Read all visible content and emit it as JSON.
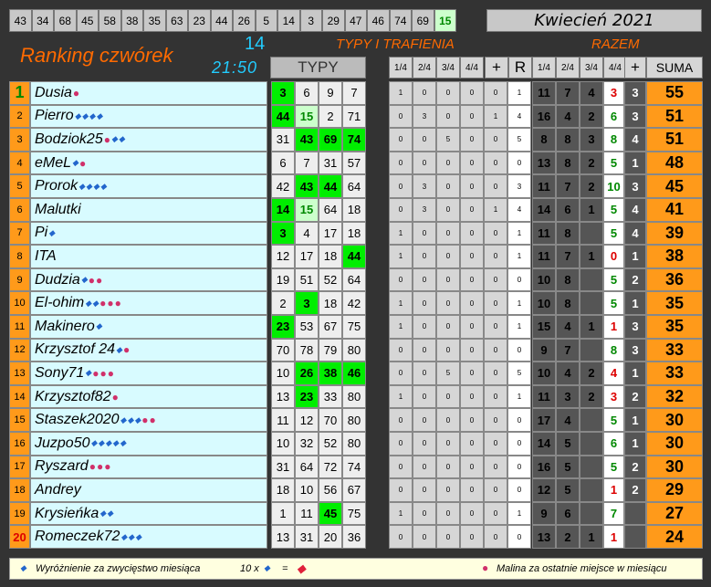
{
  "header": {
    "top_numbers": [
      "43",
      "34",
      "68",
      "45",
      "58",
      "38",
      "35",
      "63",
      "23",
      "44",
      "26",
      "5",
      "14",
      "3",
      "29",
      "47",
      "46",
      "74",
      "69",
      "15"
    ],
    "highlight_index": 19,
    "month": "Kwiecień 2021",
    "title": "Ranking czwórek",
    "draw_count": "14",
    "time": "21:50",
    "typy_label": "TYPY",
    "typy_trafienia": "TYPY I TRAFIENIA",
    "razem": "RAZEM",
    "col_labels": [
      "1/4",
      "2/4",
      "3/4",
      "4/4",
      "+",
      "R",
      "1/4",
      "2/4",
      "3/4",
      "4/4",
      "+"
    ],
    "suma": "SUMA"
  },
  "rows": [
    {
      "rank": "1",
      "name": "Dusia",
      "marks": "b",
      "picks": [
        "3",
        "6",
        "9",
        "7"
      ],
      "green": [
        0
      ],
      "lg": [],
      "t": [
        "1",
        "0",
        "0",
        "0",
        "0",
        "1"
      ],
      "r": [
        "11",
        "7",
        "4",
        "3",
        "3"
      ],
      "r4class": "rd",
      "sum": "55"
    },
    {
      "rank": "2",
      "name": "Pierro",
      "marks": "dddd",
      "picks": [
        "44",
        "15",
        "2",
        "71"
      ],
      "green": [
        0
      ],
      "lg": [
        1
      ],
      "t": [
        "0",
        "3",
        "0",
        "0",
        "1",
        "4"
      ],
      "r": [
        "16",
        "4",
        "2",
        "6",
        "3"
      ],
      "r4class": "gn",
      "sum": "51"
    },
    {
      "rank": "3",
      "name": "Bodziok25",
      "marks": "bdd",
      "picks": [
        "31",
        "43",
        "69",
        "74"
      ],
      "green": [
        1,
        2,
        3
      ],
      "lg": [],
      "t": [
        "0",
        "0",
        "5",
        "0",
        "0",
        "5"
      ],
      "r": [
        "8",
        "8",
        "3",
        "8",
        "4"
      ],
      "r4class": "gn",
      "sum": "51"
    },
    {
      "rank": "4",
      "name": "eMeL",
      "marks": "db",
      "picks": [
        "6",
        "7",
        "31",
        "57"
      ],
      "green": [],
      "lg": [],
      "t": [
        "0",
        "0",
        "0",
        "0",
        "0",
        "0"
      ],
      "r": [
        "13",
        "8",
        "2",
        "5",
        "1"
      ],
      "r4class": "gn",
      "sum": "48"
    },
    {
      "rank": "5",
      "name": "Prorok",
      "marks": "dddd",
      "picks": [
        "42",
        "43",
        "44",
        "64"
      ],
      "green": [
        1,
        2
      ],
      "lg": [],
      "t": [
        "0",
        "3",
        "0",
        "0",
        "0",
        "3"
      ],
      "r": [
        "11",
        "7",
        "2",
        "10",
        "3"
      ],
      "r4class": "gn",
      "sum": "45"
    },
    {
      "rank": "6",
      "name": "Malutki",
      "marks": "",
      "picks": [
        "14",
        "15",
        "64",
        "18"
      ],
      "green": [
        0
      ],
      "lg": [
        1
      ],
      "t": [
        "0",
        "3",
        "0",
        "0",
        "1",
        "4"
      ],
      "r": [
        "14",
        "6",
        "1",
        "5",
        "4"
      ],
      "r4class": "gn",
      "sum": "41"
    },
    {
      "rank": "7",
      "name": "Pi",
      "marks": "d",
      "picks": [
        "3",
        "4",
        "17",
        "18"
      ],
      "green": [
        0
      ],
      "lg": [],
      "t": [
        "1",
        "0",
        "0",
        "0",
        "0",
        "1"
      ],
      "r": [
        "11",
        "8",
        "",
        "5",
        "4"
      ],
      "r4class": "gn",
      "sum": "39"
    },
    {
      "rank": "8",
      "name": "ITA",
      "marks": "",
      "picks": [
        "12",
        "17",
        "18",
        "44"
      ],
      "green": [
        3
      ],
      "lg": [],
      "t": [
        "1",
        "0",
        "0",
        "0",
        "0",
        "1"
      ],
      "r": [
        "11",
        "7",
        "1",
        "0",
        "1"
      ],
      "r4class": "rd",
      "sum": "38"
    },
    {
      "rank": "9",
      "name": "Dudzia",
      "marks": "dbb",
      "picks": [
        "19",
        "51",
        "52",
        "64"
      ],
      "green": [],
      "lg": [],
      "t": [
        "0",
        "0",
        "0",
        "0",
        "0",
        "0"
      ],
      "r": [
        "10",
        "8",
        "",
        "5",
        "2"
      ],
      "r4class": "gn",
      "sum": "36"
    },
    {
      "rank": "10",
      "name": "El-ohim",
      "marks": "ddbbb",
      "picks": [
        "2",
        "3",
        "18",
        "42"
      ],
      "green": [
        1
      ],
      "lg": [],
      "t": [
        "1",
        "0",
        "0",
        "0",
        "0",
        "1"
      ],
      "r": [
        "10",
        "8",
        "",
        "5",
        "1"
      ],
      "r4class": "gn",
      "sum": "35"
    },
    {
      "rank": "11",
      "name": "Makinero",
      "marks": "d",
      "picks": [
        "23",
        "53",
        "67",
        "75"
      ],
      "green": [
        0
      ],
      "lg": [],
      "t": [
        "1",
        "0",
        "0",
        "0",
        "0",
        "1"
      ],
      "r": [
        "15",
        "4",
        "1",
        "1",
        "3"
      ],
      "r4class": "rd",
      "sum": "35"
    },
    {
      "rank": "12",
      "name": "Krzysztof 24",
      "marks": "db",
      "picks": [
        "70",
        "78",
        "79",
        "80"
      ],
      "green": [],
      "lg": [],
      "t": [
        "0",
        "0",
        "0",
        "0",
        "0",
        "0"
      ],
      "r": [
        "9",
        "7",
        "",
        "8",
        "3"
      ],
      "r4class": "gn",
      "sum": "33"
    },
    {
      "rank": "13",
      "name": "Sony71",
      "marks": "dbbb",
      "picks": [
        "10",
        "26",
        "38",
        "46"
      ],
      "green": [
        1,
        2,
        3
      ],
      "lg": [],
      "t": [
        "0",
        "0",
        "5",
        "0",
        "0",
        "5"
      ],
      "r": [
        "10",
        "4",
        "2",
        "4",
        "1"
      ],
      "r4class": "rd",
      "sum": "33"
    },
    {
      "rank": "14",
      "name": "Krzysztof82",
      "marks": "b",
      "picks": [
        "13",
        "23",
        "33",
        "80"
      ],
      "green": [
        1
      ],
      "lg": [],
      "t": [
        "1",
        "0",
        "0",
        "0",
        "0",
        "1"
      ],
      "r": [
        "11",
        "3",
        "2",
        "3",
        "2"
      ],
      "r4class": "rd",
      "sum": "32"
    },
    {
      "rank": "15",
      "name": "Staszek2020",
      "marks": "dddbb",
      "picks": [
        "11",
        "12",
        "70",
        "80"
      ],
      "green": [],
      "lg": [],
      "t": [
        "0",
        "0",
        "0",
        "0",
        "0",
        "0"
      ],
      "r": [
        "17",
        "4",
        "",
        "5",
        "1"
      ],
      "r4class": "gn",
      "sum": "30"
    },
    {
      "rank": "16",
      "name": "Juzpo50",
      "marks": "ddddd",
      "picks": [
        "10",
        "32",
        "52",
        "80"
      ],
      "green": [],
      "lg": [],
      "t": [
        "0",
        "0",
        "0",
        "0",
        "0",
        "0"
      ],
      "r": [
        "14",
        "5",
        "",
        "6",
        "1"
      ],
      "r4class": "gn",
      "sum": "30"
    },
    {
      "rank": "17",
      "name": "Ryszard",
      "marks": "bbb",
      "picks": [
        "31",
        "64",
        "72",
        "74"
      ],
      "green": [],
      "lg": [],
      "t": [
        "0",
        "0",
        "0",
        "0",
        "0",
        "0"
      ],
      "r": [
        "16",
        "5",
        "",
        "5",
        "2"
      ],
      "r4class": "gn",
      "sum": "30"
    },
    {
      "rank": "18",
      "name": "Andrey",
      "marks": "",
      "picks": [
        "18",
        "10",
        "56",
        "67"
      ],
      "green": [],
      "lg": [],
      "t": [
        "0",
        "0",
        "0",
        "0",
        "0",
        "0"
      ],
      "r": [
        "12",
        "5",
        "",
        "1",
        "2"
      ],
      "r4class": "rd",
      "sum": "29"
    },
    {
      "rank": "19",
      "name": "Krysieńka",
      "marks": "dd",
      "picks": [
        "1",
        "11",
        "45",
        "75"
      ],
      "green": [
        2
      ],
      "lg": [],
      "t": [
        "1",
        "0",
        "0",
        "0",
        "0",
        "1"
      ],
      "r": [
        "9",
        "6",
        "",
        "7",
        ""
      ],
      "r4class": "gn",
      "sum": "27"
    },
    {
      "rank": "20",
      "name": "Romeczek72",
      "marks": "ddd",
      "picks": [
        "13",
        "31",
        "20",
        "36"
      ],
      "green": [],
      "lg": [],
      "t": [
        "0",
        "0",
        "0",
        "0",
        "0",
        "0"
      ],
      "r": [
        "13",
        "2",
        "1",
        "1",
        ""
      ],
      "r4class": "rd",
      "sum": "24"
    }
  ],
  "footer": {
    "left": "Wyróżnienie za zwycięstwo miesiąca",
    "times": "10 x",
    "eq": "=",
    "right": "Malina za ostatnie miejsce w miesiącu"
  }
}
